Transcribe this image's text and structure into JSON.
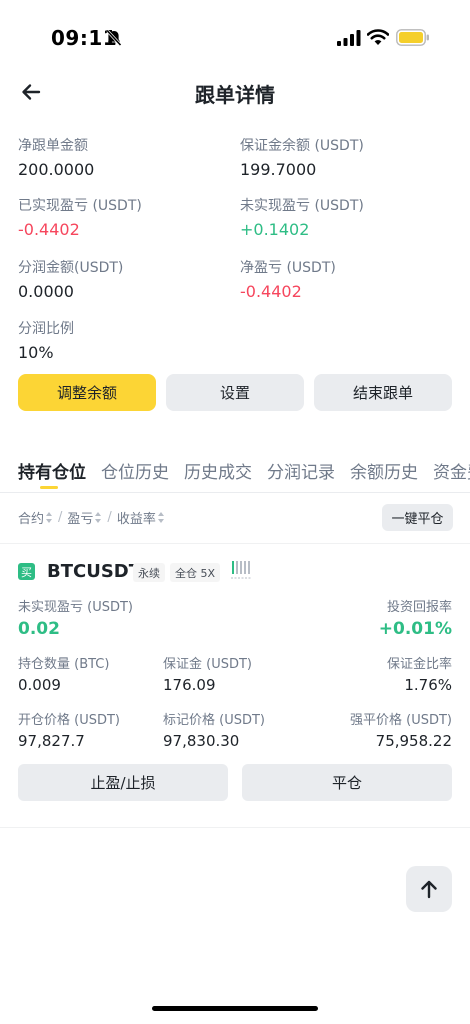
{
  "status_bar": {
    "time": "09:11"
  },
  "header": {
    "title": "跟单详情"
  },
  "stats": [
    {
      "label": "净跟单金额",
      "value": "200.0000",
      "tone": "normal"
    },
    {
      "label": "保证金余额 (USDT)",
      "value": "199.7000",
      "tone": "normal"
    },
    {
      "label": "已实现盈亏 (USDT)",
      "value": "-0.4402",
      "tone": "neg"
    },
    {
      "label": "未实现盈亏 (USDT)",
      "value": "+0.1402",
      "tone": "pos"
    },
    {
      "label": "分润金额(USDT)",
      "value": "0.0000",
      "tone": "normal"
    },
    {
      "label": "净盈亏 (USDT)",
      "value": "-0.4402",
      "tone": "neg"
    },
    {
      "label": "分润比例",
      "value": "10%",
      "tone": "normal"
    }
  ],
  "actions": {
    "adjust": "调整余额",
    "settings": "设置",
    "end": "结束跟单"
  },
  "tabs": [
    "持有仓位",
    "仓位历史",
    "历史成交",
    "分润记录",
    "余额历史",
    "资金费"
  ],
  "sort": {
    "contract": "合约",
    "pnl": "盈亏",
    "roi": "收益率",
    "close_all": "一键平仓"
  },
  "position": {
    "side": "买",
    "symbol": "BTCUSDT",
    "tag_perp": "永续",
    "tag_margin": "全仓 5X",
    "unrealized_label": "未实现盈亏 (USDT)",
    "unrealized_value": "0.02",
    "roi_label": "投资回报率",
    "roi_value": "+0.01%",
    "size_label": "持仓数量 (BTC)",
    "size_value": "0.009",
    "margin_label": "保证金 (USDT)",
    "margin_value": "176.09",
    "margin_ratio_label": "保证金比率",
    "margin_ratio_value": "1.76%",
    "entry_label": "开仓价格 (USDT)",
    "entry_value": "97,827.7",
    "mark_label": "标记价格 (USDT)",
    "mark_value": "97,830.30",
    "liq_label": "强平价格 (USDT)",
    "liq_value": "75,958.22",
    "tp_sl": "止盈/止损",
    "close": "平仓"
  },
  "colors": {
    "accent": "#fcd535",
    "positive": "#2ebd85",
    "negative": "#f6465d"
  }
}
